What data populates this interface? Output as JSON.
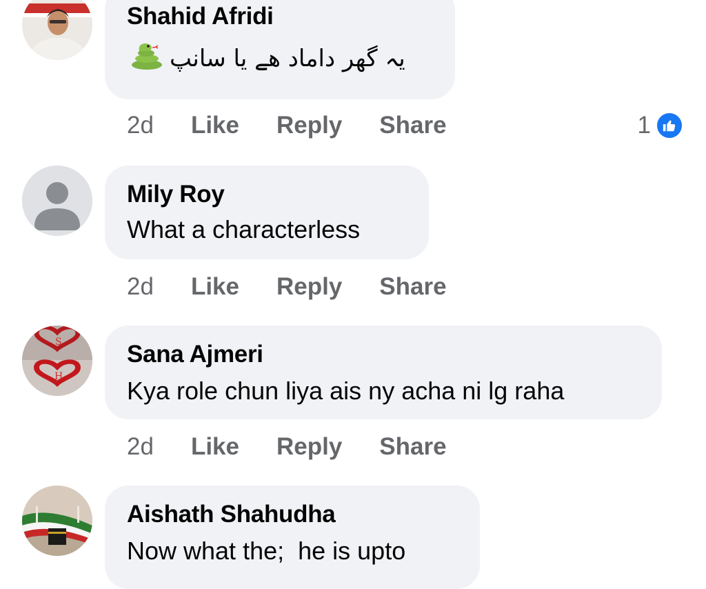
{
  "comments": [
    {
      "author": "Shahid Afridi",
      "text": "یہ گھر داماد ھے یا سانپ",
      "emoji": "snake-icon",
      "time": "2d",
      "actions": [
        "Like",
        "Reply",
        "Share"
      ],
      "reaction_count": "1"
    },
    {
      "author": "Mily Roy",
      "text": "What a characterless",
      "time": "2d",
      "actions": [
        "Like",
        "Reply",
        "Share"
      ]
    },
    {
      "author": "Sana Ajmeri",
      "text": "Kya role chun liya ais ny acha ni lg raha",
      "time": "2d",
      "actions": [
        "Like",
        "Reply",
        "Share"
      ]
    },
    {
      "author": "Aishath Shahudha",
      "text": "Now what the;  he is upto"
    }
  ],
  "colors": {
    "bubble": "#f0f2f5",
    "meta": "#65676b",
    "like_blue": "#1877f2"
  }
}
